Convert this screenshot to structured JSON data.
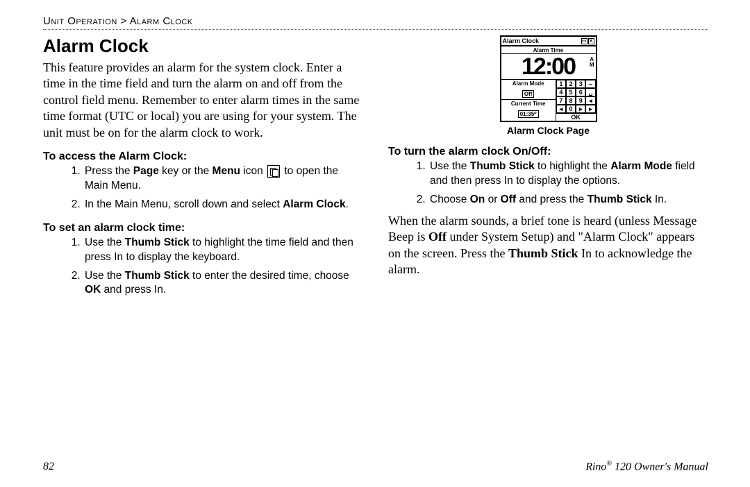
{
  "breadcrumb": {
    "section": "Unit Operation",
    "sep": ">",
    "page": "Alarm Clock"
  },
  "left": {
    "heading": "Alarm Clock",
    "intro": "This feature provides an alarm for the system clock. Enter a time in the time field and turn the alarm on and off from the control field menu. Remember to enter alarm times in the same time format (UTC or local) you are using for your system. The unit must be on for the alarm clock to work.",
    "access": {
      "title": "To access the Alarm Clock:",
      "steps": [
        {
          "pre": "Press the ",
          "b1": "Page",
          "mid1": " key or the ",
          "b2": "Menu",
          "mid2": " icon ",
          "post": " to open the Main Menu."
        },
        {
          "pre": "In the Main Menu, scroll down and select ",
          "b1": "Alarm Clock",
          "post": "."
        }
      ]
    },
    "set": {
      "title": "To set an alarm clock time:",
      "steps": [
        {
          "pre": "Use the ",
          "b1": "Thumb Stick",
          "post": " to highlight the time field and then press In to display the keyboard."
        },
        {
          "pre": "Use the ",
          "b1": "Thumb Stick",
          "mid1": " to enter the desired time, choose ",
          "b2": "OK",
          "post": " and press In."
        }
      ]
    }
  },
  "right": {
    "screenshot": {
      "title": "Alarm Clock",
      "alarm_time_label": "Alarm Time",
      "big_time": "12:00",
      "ampm": "AM",
      "alarm_mode_label": "Alarm Mode",
      "alarm_mode_value": "Off",
      "current_time_label": "Current Time",
      "current_time_value": "01:35ᴾ",
      "keypad": [
        "1",
        "2",
        "3",
        "–",
        "4",
        "5",
        "6",
        "␣",
        "7",
        "8",
        "9",
        "◂",
        "◂",
        "0",
        "▸",
        "▸"
      ],
      "ok": "OK"
    },
    "caption": "Alarm Clock Page",
    "onoff": {
      "title": "To turn the alarm clock On/Off:",
      "steps": [
        {
          "pre": "Use the ",
          "b1": "Thumb Stick",
          "mid1": " to highlight the ",
          "b2": "Alarm Mode",
          "post": " field and then press In to display the options."
        },
        {
          "pre": "Choose ",
          "b1": "On",
          "mid1": " or ",
          "b2": "Off",
          "mid2": " and press the ",
          "b3": "Thumb Stick",
          "post": " In."
        }
      ]
    },
    "closing": {
      "a": "When the alarm sounds, a brief tone is heard (unless Message Beep is ",
      "b1": "Off",
      "b": " under System Setup) and \"Alarm Clock\" appears on the screen. Press the ",
      "b2": "Thumb Stick",
      "c": " In to acknowledge the alarm."
    }
  },
  "footer": {
    "page_number": "82",
    "doc_title_a": "Rino",
    "doc_title_reg": "®",
    "doc_title_b": " 120 Owner's Manual"
  }
}
